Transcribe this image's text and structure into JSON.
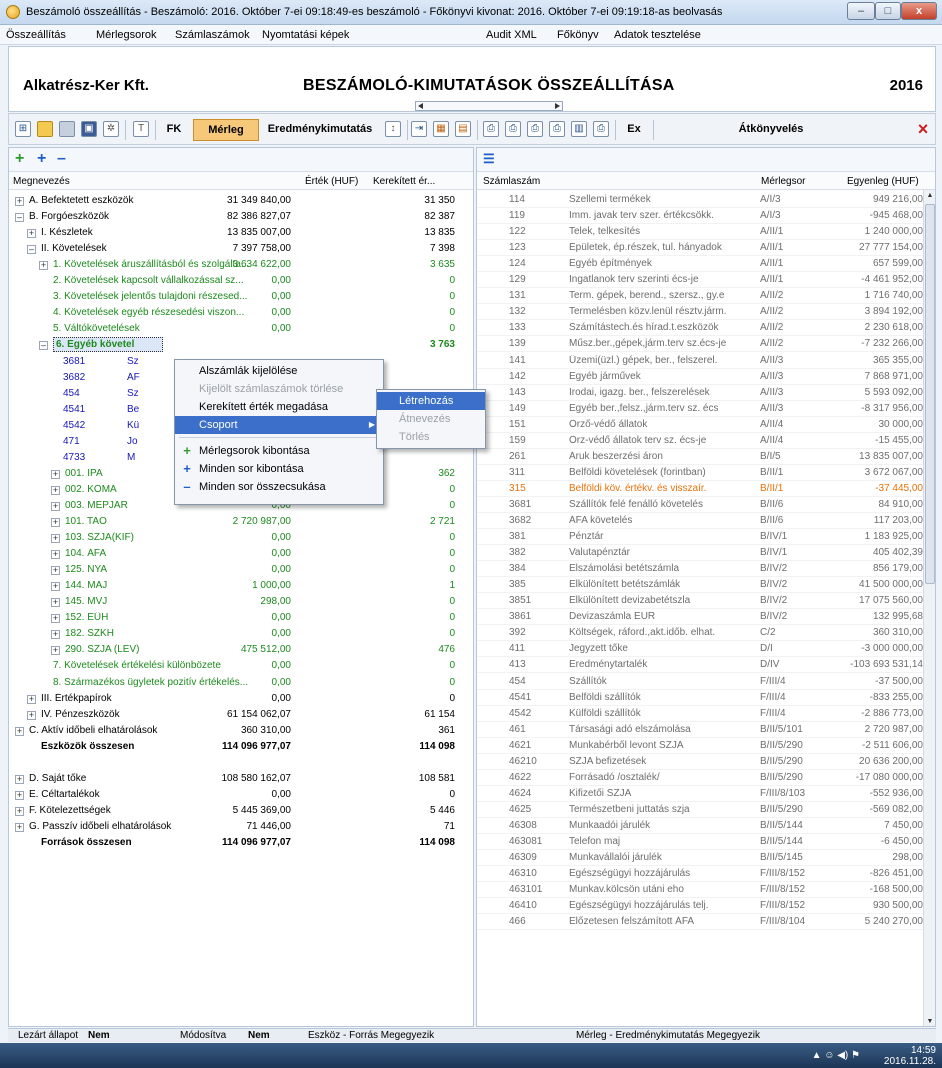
{
  "window": {
    "title": "Beszámoló összeállítás - Beszámoló: 2016. Október 7-ei 09:18:49-es beszámoló - Főkönyvi kivonat: 2016. Október 7-ei 09:19:18-as beolvasás",
    "minimize": "–",
    "maximize": "□",
    "close": "x"
  },
  "menu": {
    "items": [
      "Összeállítás",
      "Mérlegsorok",
      "Számlaszámok",
      "Nyomtatási képek"
    ],
    "right_items": [
      "Audit XML",
      "Főkönyv",
      "Adatok tesztelése"
    ]
  },
  "header": {
    "company": "Alkatrész-Ker Kft.",
    "title": "BESZÁMOLÓ-KIMUTATÁSOK ÖSSZEÁLLÍTÁSA",
    "year": "2016"
  },
  "toolbar": {
    "fk": "FK",
    "merleg": "Mérleg",
    "eredmeny": "Eredménykimutatás",
    "ex": "Ex",
    "atkonyveles": "Átkönyvelés",
    "close_icon": "×"
  },
  "left": {
    "mini_icons": [
      "+",
      "+",
      "–"
    ],
    "headers": {
      "name": "Megnevezés",
      "value": "Érték (HUF)",
      "rounded": "Kerekített ér..."
    },
    "rows": [
      {
        "label": "A. Befektetett eszközök",
        "v1": "31 349 840,00",
        "v2": "31 350",
        "indent": 0,
        "exp": "+",
        "color": "black",
        "bold": false
      },
      {
        "label": "B. Forgóeszközök",
        "v1": "82 386 827,07",
        "v2": "82 387",
        "indent": 0,
        "exp": "–",
        "color": "black",
        "bold": false
      },
      {
        "label": "I. Készletek",
        "v1": "13 835 007,00",
        "v2": "13 835",
        "indent": 1,
        "exp": "+",
        "color": "black",
        "bold": false
      },
      {
        "label": "II. Követelések",
        "v1": "7 397 758,00",
        "v2": "7 398",
        "indent": 1,
        "exp": "–",
        "color": "black",
        "bold": false
      },
      {
        "label": "1. Követelések áruszállításból és szolgálta...",
        "v1": "3 634 622,00",
        "v2": "3 635",
        "indent": 2,
        "exp": "+",
        "color": "green",
        "bold": false
      },
      {
        "label": "2. Követelések kapcsolt vállalkozással sz...",
        "v1": "0,00",
        "v2": "0",
        "indent": 2,
        "exp": "",
        "color": "green",
        "bold": false
      },
      {
        "label": "3. Követelések jelentős tulajdoni részesed...",
        "v1": "0,00",
        "v2": "0",
        "indent": 2,
        "exp": "",
        "color": "green",
        "bold": false
      },
      {
        "label": "4. Követelések egyéb részesedési viszon...",
        "v1": "0,00",
        "v2": "0",
        "indent": 2,
        "exp": "",
        "color": "green",
        "bold": false
      },
      {
        "label": "5. Váltókövetelések",
        "v1": "0,00",
        "v2": "0",
        "indent": 2,
        "exp": "",
        "color": "green",
        "bold": false
      },
      {
        "label": "6. Egyéb követel",
        "v1": "",
        "v2": "3 763",
        "indent": 2,
        "exp": "–",
        "color": "green",
        "bold": true,
        "selected": true
      },
      {
        "label": "3681",
        "v1": "",
        "v2": "",
        "indent": 3,
        "exp": "",
        "color": "blue",
        "bold": false,
        "tail": "Sz"
      },
      {
        "label": "3682",
        "v1": "",
        "v2": "",
        "indent": 3,
        "exp": "",
        "color": "blue",
        "bold": false,
        "tail": "ÁF"
      },
      {
        "label": "454",
        "v1": "",
        "v2": "",
        "indent": 3,
        "exp": "",
        "color": "blue",
        "bold": false,
        "tail": "Sz"
      },
      {
        "label": "4541",
        "v1": "",
        "v2": "",
        "indent": 3,
        "exp": "",
        "color": "blue",
        "bold": false,
        "tail": "Be"
      },
      {
        "label": "4542",
        "v1": "",
        "v2": "",
        "indent": 3,
        "exp": "",
        "color": "blue",
        "bold": false,
        "tail": "Kü"
      },
      {
        "label": "471",
        "v1": "",
        "v2": "",
        "indent": 3,
        "exp": "",
        "color": "blue",
        "bold": false,
        "tail": "Jo"
      },
      {
        "label": "4733",
        "v1": "",
        "v2": "",
        "indent": 3,
        "exp": "",
        "color": "blue",
        "bold": false,
        "tail": "M"
      },
      {
        "label": "001. IPA",
        "v1": "362 106,00",
        "v2": "362",
        "indent": 3,
        "exp": "+",
        "color": "green",
        "bold": false
      },
      {
        "label": "002. KOMA",
        "v1": "0,00",
        "v2": "0",
        "indent": 3,
        "exp": "+",
        "color": "green",
        "bold": false
      },
      {
        "label": "003. MEPJAR",
        "v1": "0,00",
        "v2": "0",
        "indent": 3,
        "exp": "+",
        "color": "green",
        "bold": false
      },
      {
        "label": "101. TAO",
        "v1": "2 720 987,00",
        "v2": "2 721",
        "indent": 3,
        "exp": "+",
        "color": "green",
        "bold": false
      },
      {
        "label": "103. SZJA(KIF)",
        "v1": "0,00",
        "v2": "0",
        "indent": 3,
        "exp": "+",
        "color": "green",
        "bold": false
      },
      {
        "label": "104. ÁFA",
        "v1": "0,00",
        "v2": "0",
        "indent": 3,
        "exp": "+",
        "color": "green",
        "bold": false
      },
      {
        "label": "125. NYA",
        "v1": "0,00",
        "v2": "0",
        "indent": 3,
        "exp": "+",
        "color": "green",
        "bold": false
      },
      {
        "label": "144. MAJ",
        "v1": "1 000,00",
        "v2": "1",
        "indent": 3,
        "exp": "+",
        "color": "green",
        "bold": false
      },
      {
        "label": "145. MVJ",
        "v1": "298,00",
        "v2": "0",
        "indent": 3,
        "exp": "+",
        "color": "green",
        "bold": false
      },
      {
        "label": "152. EÜH",
        "v1": "0,00",
        "v2": "0",
        "indent": 3,
        "exp": "+",
        "color": "green",
        "bold": false
      },
      {
        "label": "182. SZKH",
        "v1": "0,00",
        "v2": "0",
        "indent": 3,
        "exp": "+",
        "color": "green",
        "bold": false
      },
      {
        "label": "290. SZJA (LEV)",
        "v1": "475 512,00",
        "v2": "476",
        "indent": 3,
        "exp": "+",
        "color": "green",
        "bold": false
      },
      {
        "label": "7. Követelések értékelési különbözete",
        "v1": "0,00",
        "v2": "0",
        "indent": 2,
        "exp": "",
        "color": "green",
        "bold": false
      },
      {
        "label": "8. Származékos ügyletek pozitív értékelés...",
        "v1": "0,00",
        "v2": "0",
        "indent": 2,
        "exp": "",
        "color": "green",
        "bold": false
      },
      {
        "label": "III. Értékpapírok",
        "v1": "0,00",
        "v2": "0",
        "indent": 1,
        "exp": "+",
        "color": "black",
        "bold": false
      },
      {
        "label": "IV. Pénzeszközök",
        "v1": "61 154 062,07",
        "v2": "61 154",
        "indent": 1,
        "exp": "+",
        "color": "black",
        "bold": false
      },
      {
        "label": "C. Aktív időbeli elhatárolások",
        "v1": "360 310,00",
        "v2": "361",
        "indent": 0,
        "exp": "+",
        "color": "black",
        "bold": false
      },
      {
        "label": "Eszközök összesen",
        "v1": "114 096 977,07",
        "v2": "114 098",
        "indent": 1,
        "exp": "",
        "color": "black",
        "bold": true
      },
      {
        "label": "",
        "v1": "",
        "v2": "",
        "indent": 0,
        "exp": "",
        "color": "black",
        "bold": false
      },
      {
        "label": "D. Saját tőke",
        "v1": "108 580 162,07",
        "v2": "108 581",
        "indent": 0,
        "exp": "+",
        "color": "black",
        "bold": false
      },
      {
        "label": "E. Céltartalékok",
        "v1": "0,00",
        "v2": "0",
        "indent": 0,
        "exp": "+",
        "color": "black",
        "bold": false
      },
      {
        "label": "F. Kötelezettségek",
        "v1": "5 445 369,00",
        "v2": "5 446",
        "indent": 0,
        "exp": "+",
        "color": "black",
        "bold": false
      },
      {
        "label": "G. Passzív időbeli elhatárolások",
        "v1": "71 446,00",
        "v2": "71",
        "indent": 0,
        "exp": "+",
        "color": "black",
        "bold": false
      },
      {
        "label": "Források összesen",
        "v1": "114 096 977,07",
        "v2": "114 098",
        "indent": 1,
        "exp": "",
        "color": "black",
        "bold": true
      }
    ]
  },
  "right": {
    "mini_icon": "☰",
    "headers": {
      "acc": "Számlaszám",
      "line": "Mérlegsor",
      "bal": "Egyenleg (HUF)"
    },
    "rows": [
      [
        "114",
        "Szellemi termékek",
        "A/I/3",
        "949 216,00"
      ],
      [
        "119",
        "Imm. javak terv szer. értékcsökk.",
        "A/I/3",
        "-945 468,00"
      ],
      [
        "122",
        "Telek, telkesítés",
        "A/II/1",
        "1 240 000,00"
      ],
      [
        "123",
        "Épületek, ép.részek, tul. hányadok",
        "A/II/1",
        "27 777 154,00"
      ],
      [
        "124",
        "Egyéb építmények",
        "A/II/1",
        "657 599,00"
      ],
      [
        "129",
        "Ingatlanok terv szerinti écs-je",
        "A/II/1",
        "-4 461 952,00"
      ],
      [
        "131",
        "Term. gépek, berend., szersz., gy.e",
        "A/II/2",
        "1 716 740,00"
      ],
      [
        "132",
        "Termelésben közv.lenül résztv.járm.",
        "A/II/2",
        "3 894 192,00"
      ],
      [
        "133",
        "Számítástech.és hírad.t.eszközök",
        "A/II/2",
        "2 230 618,00"
      ],
      [
        "139",
        "Műsz.ber.,gépek,járm.terv sz.écs-je",
        "A/II/2",
        "-7 232 266,00"
      ],
      [
        "141",
        "Üzemi(üzl.) gépek, ber., felszerel.",
        "A/II/3",
        "365 355,00"
      ],
      [
        "142",
        "Egyéb járművek",
        "A/II/3",
        "7 868 971,00"
      ],
      [
        "143",
        "Irodai, igazg. ber., felszerelések",
        "A/II/3",
        "5 593 092,00"
      ],
      [
        "149",
        "Egyéb ber.,felsz.,járm.terv sz. écs",
        "A/II/3",
        "-8 317 956,00"
      ],
      [
        "151",
        "Őrző-védő állatok",
        "A/II/4",
        "30 000,00"
      ],
      [
        "159",
        "Őrz-védő állatok terv sz. écs-je",
        "A/II/4",
        "-15 455,00"
      ],
      [
        "261",
        "Áruk beszerzési áron",
        "B/I/5",
        "13 835 007,00"
      ],
      [
        "311",
        "Belföldi követelések (forintban)",
        "B/II/1",
        "3 672 067,00"
      ],
      [
        "315",
        "Belföldi köv. értékv. és visszaír.",
        "B/II/1",
        "-37 445,00",
        "orange"
      ],
      [
        "3681",
        "Szállítók felé fenálló követelés",
        "B/II/6",
        "84 910,00"
      ],
      [
        "3682",
        "ÁFA követelés",
        "B/II/6",
        "117 203,00"
      ],
      [
        "381",
        "Pénztár",
        "B/IV/1",
        "1 183 925,00"
      ],
      [
        "382",
        "Valutapénztár",
        "B/IV/1",
        "405 402,39"
      ],
      [
        "384",
        "Elszámolási betétszámla",
        "B/IV/2",
        "856 179,00"
      ],
      [
        "385",
        "Elkülönített betétszámlák",
        "B/IV/2",
        "41 500 000,00"
      ],
      [
        "3851",
        "Elkülönített devizabetétszla",
        "B/IV/2",
        "17 075 560,00"
      ],
      [
        "3861",
        "Devizaszámla EUR",
        "B/IV/2",
        "132 995,68"
      ],
      [
        "392",
        "Költségek, ráford.,akt.időb. elhat.",
        "C/2",
        "360 310,00"
      ],
      [
        "411",
        "Jegyzett tőke",
        "D/I",
        "-3 000 000,00"
      ],
      [
        "413",
        "Eredménytartalék",
        "D/IV",
        "-103 693 531,14"
      ],
      [
        "454",
        "Szállítók",
        "F/III/4",
        "-37 500,00"
      ],
      [
        "4541",
        "Belföldi szállítók",
        "F/III/4",
        "-833 255,00"
      ],
      [
        "4542",
        "Külföldi szállítók",
        "F/III/4",
        "-2 886 773,00"
      ],
      [
        "461",
        "Társasági adó elszámolása",
        "B/II/5/101",
        "2 720 987,00"
      ],
      [
        "4621",
        "Munkabérből levont SZJA",
        "B/II/5/290",
        "-2 511 606,00"
      ],
      [
        "46210",
        "SZJA befizetések",
        "B/II/5/290",
        "20 636 200,00"
      ],
      [
        "4622",
        "Forrásadó /osztalék/",
        "B/II/5/290",
        "-17 080 000,00"
      ],
      [
        "4624",
        "Kifizetői SZJA",
        "F/III/8/103",
        "-552 936,00"
      ],
      [
        "4625",
        "Természetbeni juttatás szja",
        "B/II/5/290",
        "-569 082,00"
      ],
      [
        "46308",
        "Munkaadói járulék",
        "B/II/5/144",
        "7 450,00"
      ],
      [
        "463081",
        "Telefon maj",
        "B/II/5/144",
        "-6 450,00"
      ],
      [
        "46309",
        "Munkavállalói járulék",
        "B/II/5/145",
        "298,00"
      ],
      [
        "46310",
        "Egészségügyi hozzájárulás",
        "F/III/8/152",
        "-826 451,00"
      ],
      [
        "463101",
        "Munkav.kölcsön utáni eho",
        "F/III/8/152",
        "-168 500,00"
      ],
      [
        "46410",
        "Egészségügyi hozzájárulás telj.",
        "F/III/8/152",
        "930 500,00"
      ],
      [
        "466",
        "Előzetesen felszámított ÁFA",
        "F/III/8/104",
        "5 240 270,00"
      ]
    ]
  },
  "context_menu": {
    "items": [
      {
        "label": "Alszámlák kijelölése",
        "disabled": false,
        "icon": ""
      },
      {
        "label": "Kijelölt számlaszámok törlése",
        "disabled": true,
        "icon": ""
      },
      {
        "label": "Kerekített érték megadása",
        "disabled": false,
        "icon": ""
      },
      {
        "label": "Csoport",
        "disabled": false,
        "icon": "",
        "selected": true,
        "arrow": "▶"
      },
      {
        "label": "Mérlegsorok kibontása",
        "disabled": false,
        "icon": "+"
      },
      {
        "label": "Minden sor kibontása",
        "disabled": false,
        "icon": "+"
      },
      {
        "label": "Minden sor összecsukása",
        "disabled": false,
        "icon": "–"
      }
    ],
    "submenu": [
      "Létrehozás",
      "Átnevezés",
      "Törlés"
    ]
  },
  "status": {
    "locked_label": "Lezárt állapot",
    "locked_value": "Nem",
    "modified_label": "Módosítva",
    "modified_value": "Nem",
    "check1": "Eszköz - Forrás Megegyezik",
    "check2": "Mérleg - Eredménykimutatás Megegyezik"
  },
  "taskbar": {
    "time": "14:59",
    "date": "2016.11.28.",
    "tray": "▲ ☺ ◀) ⚑"
  },
  "colors": {
    "green": "#1d8a1d",
    "blue": "#1717b8",
    "orange": "#e8720c",
    "selection": "#3b6fc9",
    "close_red": "#c8201a"
  }
}
